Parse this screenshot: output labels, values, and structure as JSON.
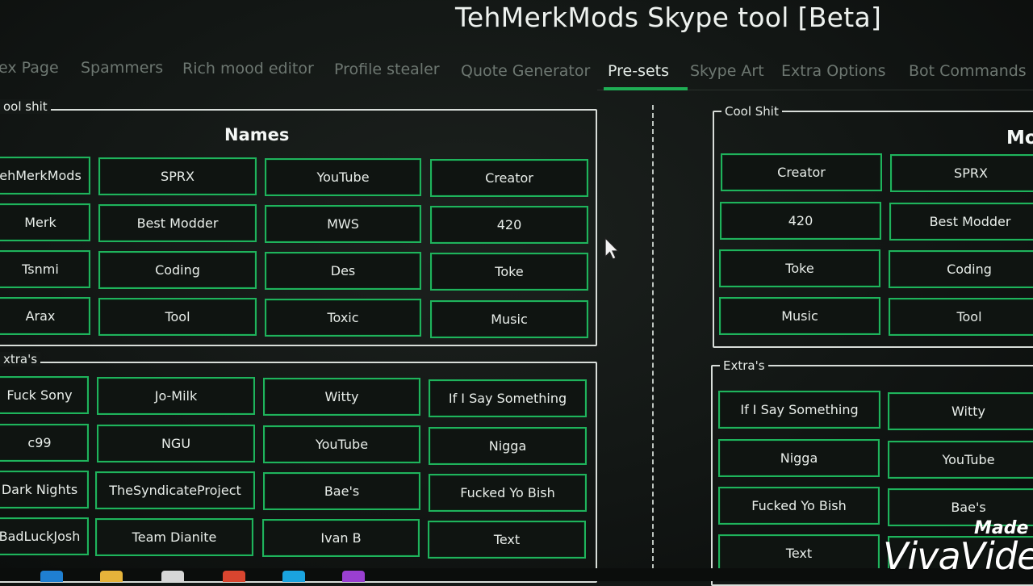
{
  "window": {
    "title": "TehMerkMods Skype tool  [Beta]"
  },
  "tabs": [
    {
      "label": "ex Page",
      "active": false
    },
    {
      "label": "Spammers",
      "active": false
    },
    {
      "label": "Rich mood editor",
      "active": false
    },
    {
      "label": "Profile stealer",
      "active": false
    },
    {
      "label": "Quote Generator",
      "active": false
    },
    {
      "label": "Pre-sets",
      "active": true
    },
    {
      "label": "Skype Art",
      "active": false
    },
    {
      "label": "Extra Options",
      "active": false
    },
    {
      "label": "Bot Commands",
      "active": false
    }
  ],
  "left": {
    "cool_group_label": "ool shit",
    "names_title": "Names",
    "names": [
      [
        "ehMerkMods",
        "SPRX",
        "YouTube",
        "Creator"
      ],
      [
        "Merk",
        "Best Modder",
        "MWS",
        "420"
      ],
      [
        "Tsnmi",
        "Coding",
        "Des",
        "Toke"
      ],
      [
        "Arax",
        "Tool",
        "Toxic",
        "Music"
      ]
    ],
    "extras_group_label": "xtra's",
    "extras": [
      [
        "Fuck Sony",
        "Jo-Milk",
        "Witty",
        "If I Say Something"
      ],
      [
        "c99",
        "NGU",
        "YouTube",
        "Nigga"
      ],
      [
        "Dark Nights",
        "TheSyndicateProject",
        "Bae's",
        "Fucked Yo Bish"
      ],
      [
        "BadLuckJosh",
        "Team Dianite",
        "Ivan B",
        "Text"
      ]
    ]
  },
  "right": {
    "cool_group_label": "Cool Shit",
    "title_partial": "Mo",
    "buttons": [
      [
        "Creator",
        "SPRX"
      ],
      [
        "420",
        "Best Modder"
      ],
      [
        "Toke",
        "Coding"
      ],
      [
        "Music",
        "Tool"
      ]
    ],
    "extras_group_label": "Extra's",
    "extras": [
      [
        "If I Say Something",
        "Witty"
      ],
      [
        "Nigga",
        "YouTube"
      ],
      [
        "Fucked Yo Bish",
        "Bae's"
      ],
      [
        "Text",
        ""
      ]
    ]
  },
  "watermark": {
    "line1": "Made w",
    "line2": "VivaVide"
  },
  "colors": {
    "accent": "#1fb35c",
    "background": "#121614",
    "tab_inactive": "#6d7771"
  }
}
